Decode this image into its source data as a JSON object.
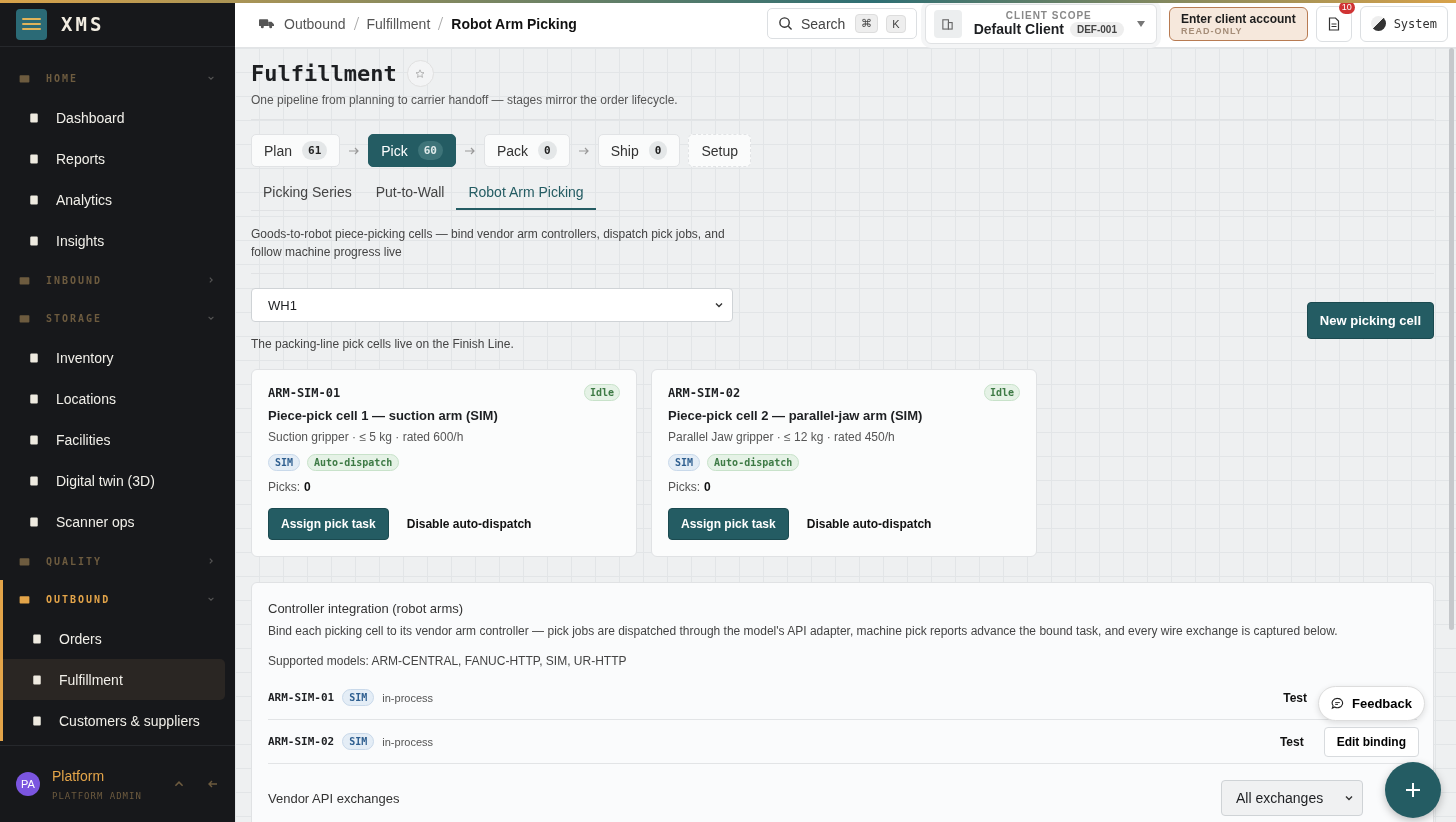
{
  "brand": "XMS",
  "sidebar": {
    "sections": [
      {
        "label": "HOME",
        "expanded": true,
        "active": false,
        "children": [
          {
            "label": "Dashboard",
            "selected": false
          },
          {
            "label": "Reports",
            "selected": false
          },
          {
            "label": "Analytics",
            "selected": false
          },
          {
            "label": "Insights",
            "selected": false
          }
        ]
      },
      {
        "label": "INBOUND",
        "expanded": false,
        "active": false
      },
      {
        "label": "STORAGE",
        "expanded": true,
        "active": false,
        "children": [
          {
            "label": "Inventory",
            "selected": false
          },
          {
            "label": "Locations",
            "selected": false
          },
          {
            "label": "Facilities",
            "selected": false
          },
          {
            "label": "Digital twin (3D)",
            "selected": false
          },
          {
            "label": "Scanner ops",
            "selected": false
          }
        ]
      },
      {
        "label": "QUALITY",
        "expanded": false,
        "active": false
      },
      {
        "label": "OUTBOUND",
        "expanded": true,
        "active": true,
        "children": [
          {
            "label": "Orders",
            "selected": false
          },
          {
            "label": "Fulfillment",
            "selected": true
          },
          {
            "label": "Customers & suppliers",
            "selected": false
          }
        ]
      }
    ],
    "user": {
      "initials": "PA",
      "name": "Platform",
      "role": "PLATFORM ADMIN"
    }
  },
  "breadcrumb": [
    "Outbound",
    "Fulfillment",
    "Robot Arm Picking"
  ],
  "search": {
    "placeholder": "Search",
    "keys": [
      "⌘",
      "K"
    ]
  },
  "client_scope": {
    "label": "CLIENT SCOPE",
    "name": "Default Client",
    "code": "DEF-001"
  },
  "enter_client": {
    "label": "Enter client account",
    "sub": "READ-ONLY"
  },
  "notifications": {
    "count": "10"
  },
  "theme": {
    "label": "System"
  },
  "page": {
    "title": "Fulfillment",
    "subtitle": "One pipeline from planning to carrier handoff — stages mirror the order lifecycle.",
    "stages": [
      {
        "kind": "stage",
        "label": "Plan",
        "count": "61",
        "selected": false
      },
      {
        "kind": "stage",
        "label": "Pick",
        "count": "60",
        "selected": true
      },
      {
        "kind": "stage",
        "label": "Pack",
        "count": "0",
        "selected": false
      },
      {
        "kind": "stage",
        "label": "Ship",
        "count": "0",
        "selected": false
      },
      {
        "kind": "setup",
        "label": "Setup",
        "selected": false
      }
    ],
    "tabs": [
      {
        "label": "Picking Series",
        "selected": false
      },
      {
        "label": "Put-to-Wall",
        "selected": false
      },
      {
        "label": "Robot Arm Picking",
        "selected": true
      }
    ],
    "description": "Goods-to-robot piece-picking cells — bind vendor arm controllers, dispatch pick jobs, and follow machine progress live",
    "warehouse": {
      "value": "WH1"
    },
    "new_button": "New picking cell",
    "note": "The packing-line pick cells live on the Finish Line.",
    "cells": [
      {
        "code": "ARM-SIM-01",
        "status": "Idle",
        "name": "Piece-pick cell 1 — suction arm (SIM)",
        "specs": "Suction gripper · ≤ 5 kg · rated 600/h",
        "tags": [
          {
            "kind": "model",
            "label": "SIM"
          },
          {
            "kind": "auto",
            "label": "Auto-dispatch"
          }
        ],
        "picks_label": "Picks:",
        "picks": "0",
        "primary": "Assign pick task",
        "secondary": "Disable auto-dispatch"
      },
      {
        "code": "ARM-SIM-02",
        "status": "Idle",
        "name": "Piece-pick cell 2 — parallel-jaw arm (SIM)",
        "specs": "Parallel Jaw gripper · ≤ 12 kg · rated 450/h",
        "tags": [
          {
            "kind": "model",
            "label": "SIM"
          },
          {
            "kind": "auto",
            "label": "Auto-dispatch"
          }
        ],
        "picks_label": "Picks:",
        "picks": "0",
        "primary": "Assign pick task",
        "secondary": "Disable auto-dispatch"
      }
    ],
    "integration": {
      "title": "Controller integration (robot arms)",
      "text": "Bind each picking cell to its vendor arm controller — pick jobs are dispatched through the model's API adapter, machine pick reports advance the bound task, and every wire exchange is captured below.",
      "models": "Supported models: ARM-CENTRAL, FANUC-HTTP, SIM, UR-HTTP",
      "bindings": [
        {
          "code": "ARM-SIM-01",
          "model": "SIM",
          "state": "in-process",
          "test": "Test"
        },
        {
          "code": "ARM-SIM-02",
          "model": "SIM",
          "state": "in-process",
          "test": "Test",
          "edit": "Edit binding"
        }
      ]
    },
    "exchanges": {
      "title": "Vendor API exchanges",
      "filter": "All exchanges"
    }
  },
  "feedback": "Feedback"
}
